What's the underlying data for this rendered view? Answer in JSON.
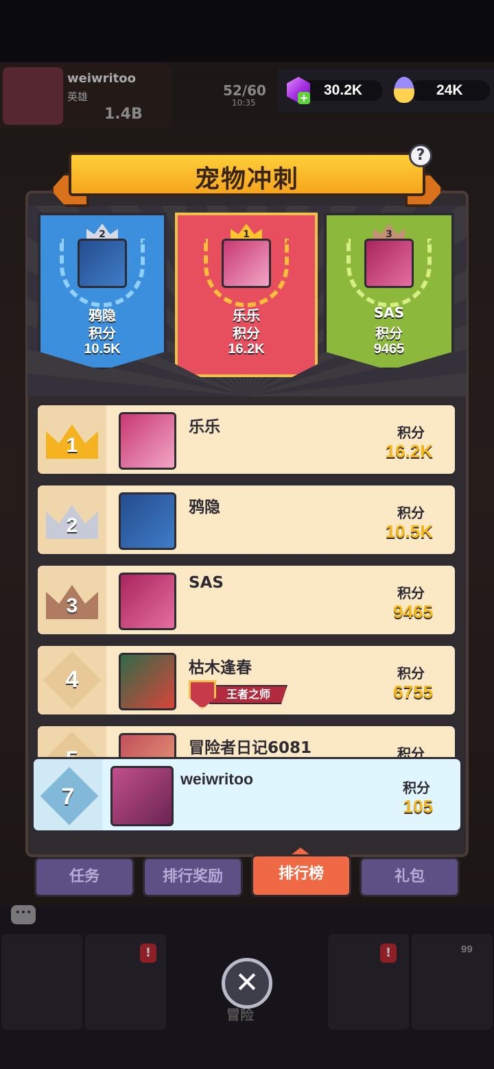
{
  "top_bar": {
    "player_name": "weiwritoo",
    "player_title": "英雄",
    "power": "1.4B",
    "energy": "52/60",
    "energy_timer": "10:35",
    "gems": "30.2K",
    "eggs": "24K"
  },
  "modal": {
    "title": "宠物冲刺",
    "help": "?"
  },
  "podium": [
    {
      "rank": "2",
      "name": "鸦隐",
      "label": "积分",
      "score": "10.5K",
      "color": "#3b8fdc"
    },
    {
      "rank": "1",
      "name": "乐乐",
      "label": "积分",
      "score": "16.2K",
      "color": "#e84f5e"
    },
    {
      "rank": "3",
      "name": "SAS",
      "label": "积分",
      "score": "9465",
      "color": "#8cb93b"
    }
  ],
  "leaderboard": [
    {
      "rank": "1",
      "name": "乐乐",
      "label": "积分",
      "score": "16.2K"
    },
    {
      "rank": "2",
      "name": "鸦隐",
      "label": "积分",
      "score": "10.5K"
    },
    {
      "rank": "3",
      "name": "SAS",
      "label": "积分",
      "score": "9465"
    },
    {
      "rank": "4",
      "name": "枯木逢春",
      "badge": "王者之师",
      "label": "积分",
      "score": "6755"
    },
    {
      "rank": "5",
      "name": "冒险者日记6081",
      "label": "积分",
      "score": ""
    }
  ],
  "self": {
    "rank": "7",
    "name": "weiwritoo",
    "label": "积分",
    "score": "105"
  },
  "tabs": [
    {
      "label": "任务"
    },
    {
      "label": "排行奖励"
    },
    {
      "label": "排行榜",
      "active": true
    },
    {
      "label": "礼包"
    }
  ],
  "bottom_nav": {
    "center_label": "冒险",
    "badge_count": "99",
    "alert": "!"
  },
  "colors": {
    "accent_orange": "#ef6a44",
    "score_gold": "#f6b71a",
    "row_bg": "#fbe9c6",
    "self_row_bg": "#dff6ff"
  }
}
